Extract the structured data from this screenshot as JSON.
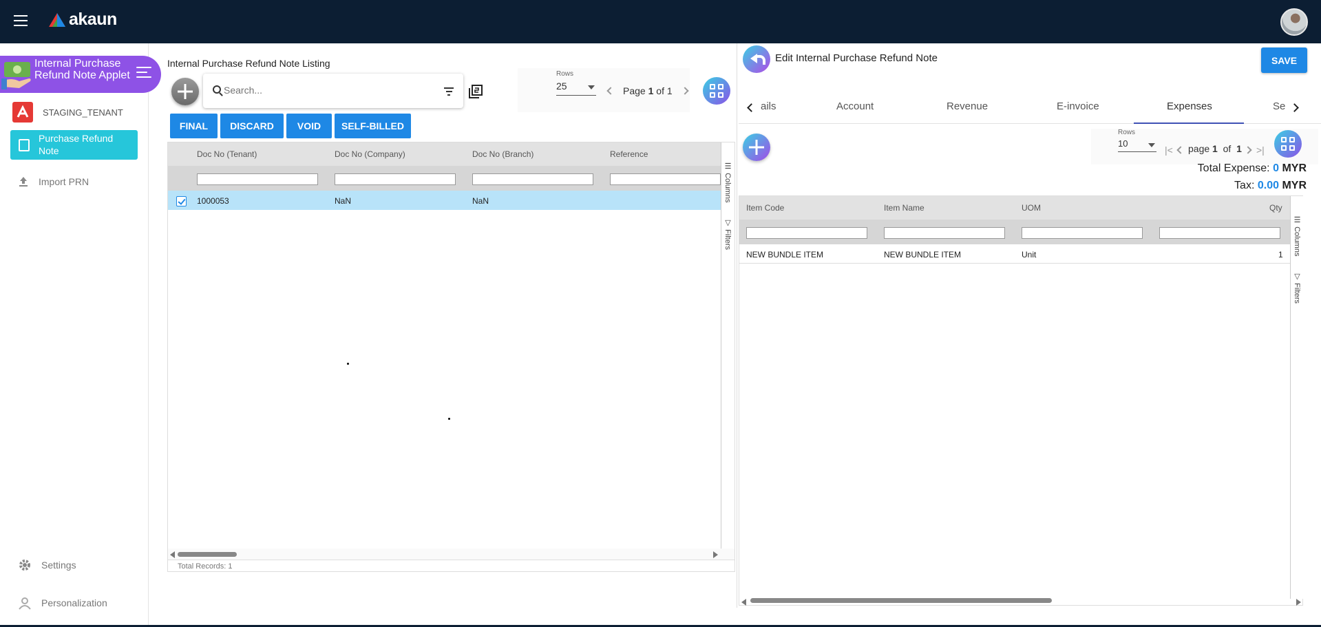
{
  "app": {
    "brand": "akaun"
  },
  "sidebar": {
    "app_title": "Internal Purchase Refund Note Applet",
    "tenant": "STAGING_TENANT",
    "active_item": "Purchase Refund Note",
    "import_item": "Import PRN",
    "settings": "Settings",
    "personalization": "Personalization"
  },
  "listing": {
    "title": "Internal Purchase Refund Note Listing",
    "search_placeholder": "Search...",
    "rows_label": "Rows",
    "rows_value": "25",
    "page_word": "Page",
    "page_current": "1",
    "page_of": "of",
    "page_total": "1",
    "actions": [
      "FINAL",
      "DISCARD",
      "VOID",
      "SELF-BILLED"
    ],
    "columns": [
      "Doc No (Tenant)",
      "Doc No (Company)",
      "Doc No (Branch)",
      "Reference"
    ],
    "rows": [
      {
        "tenant": "1000053",
        "company": "NaN",
        "branch": "NaN",
        "reference": ""
      }
    ],
    "side_columns": "Columns",
    "side_filters": "Filters",
    "total_records": "Total Records: 1"
  },
  "editor": {
    "title": "Edit Internal Purchase Refund Note",
    "save": "SAVE",
    "tabs": [
      "ails",
      "Account",
      "Revenue",
      "E-invoice",
      "Expenses",
      "Se"
    ],
    "active_tab": "Expenses",
    "rows_label": "Rows",
    "rows_value": "10",
    "page_word": "page",
    "page_current": "1",
    "page_of": "of",
    "page_total": "1",
    "total_expense_label": "Total Expense:",
    "total_expense_value": "0",
    "total_expense_currency": "MYR",
    "tax_label": "Tax:",
    "tax_value": "0.00",
    "tax_currency": "MYR",
    "columns": [
      "Item Code",
      "Item Name",
      "UOM",
      "Qty"
    ],
    "rows": [
      {
        "code": "NEW BUNDLE ITEM",
        "name": "NEW BUNDLE ITEM",
        "uom": "Unit",
        "qty": "1"
      }
    ],
    "side_columns": "Columns",
    "side_filters": "Filters"
  },
  "colors": {
    "topbar": "#0c1e33",
    "accent": "#1e88e5",
    "active_nav": "#26c6da",
    "banner": "#8e52e6"
  }
}
